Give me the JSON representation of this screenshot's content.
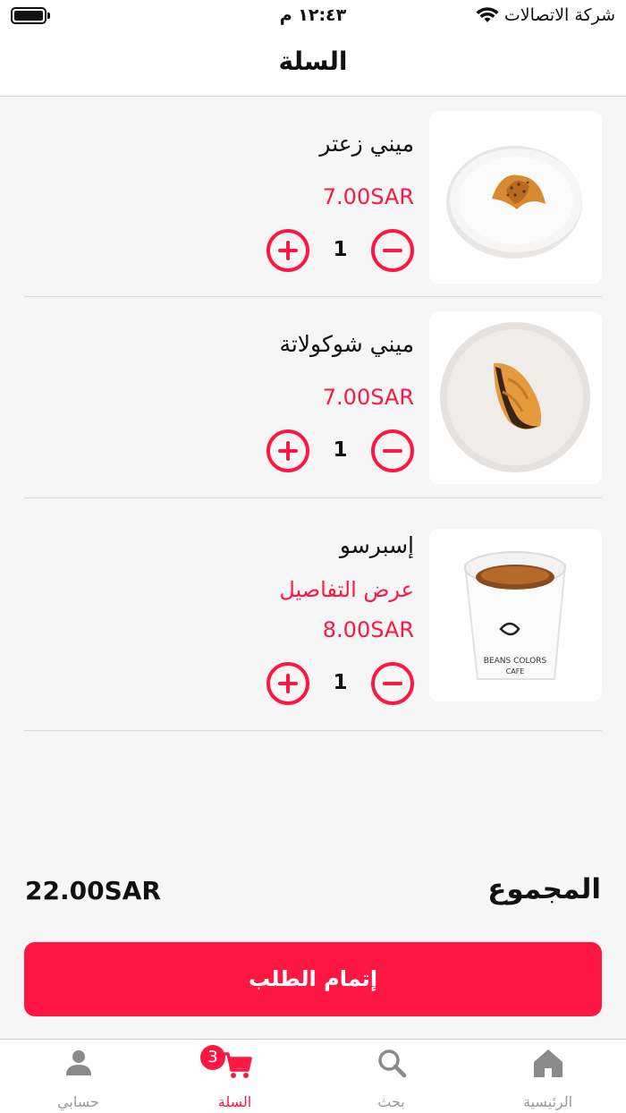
{
  "status_bar": {
    "time": "١٢:٤٣ م",
    "carrier": "شركة الاتصالات"
  },
  "header": {
    "title": "السلة"
  },
  "cart": {
    "items": [
      {
        "name": "ميني زعتر",
        "price": "7.00SAR",
        "quantity": "1"
      },
      {
        "name": "ميني شوكولاتة",
        "price": "7.00SAR",
        "quantity": "1"
      },
      {
        "name": "إسبرسو",
        "details_link": "عرض التفاصيل",
        "price": "8.00SAR",
        "quantity": "1"
      }
    ]
  },
  "summary": {
    "total_label": "المجموع",
    "total_value": "22.00SAR"
  },
  "checkout": {
    "label": "إتمام الطلب"
  },
  "bottom_nav": {
    "items": [
      {
        "label": "الرئيسية",
        "icon": "home-icon"
      },
      {
        "label": "بحث",
        "icon": "search-icon"
      },
      {
        "label": "السلة",
        "icon": "cart-icon",
        "badge": "3",
        "active": true
      },
      {
        "label": "حسابي",
        "icon": "user-icon"
      }
    ]
  },
  "colors": {
    "accent": "#ff1744",
    "inactive": "#9a9a9a",
    "background": "#f6f6f6"
  }
}
